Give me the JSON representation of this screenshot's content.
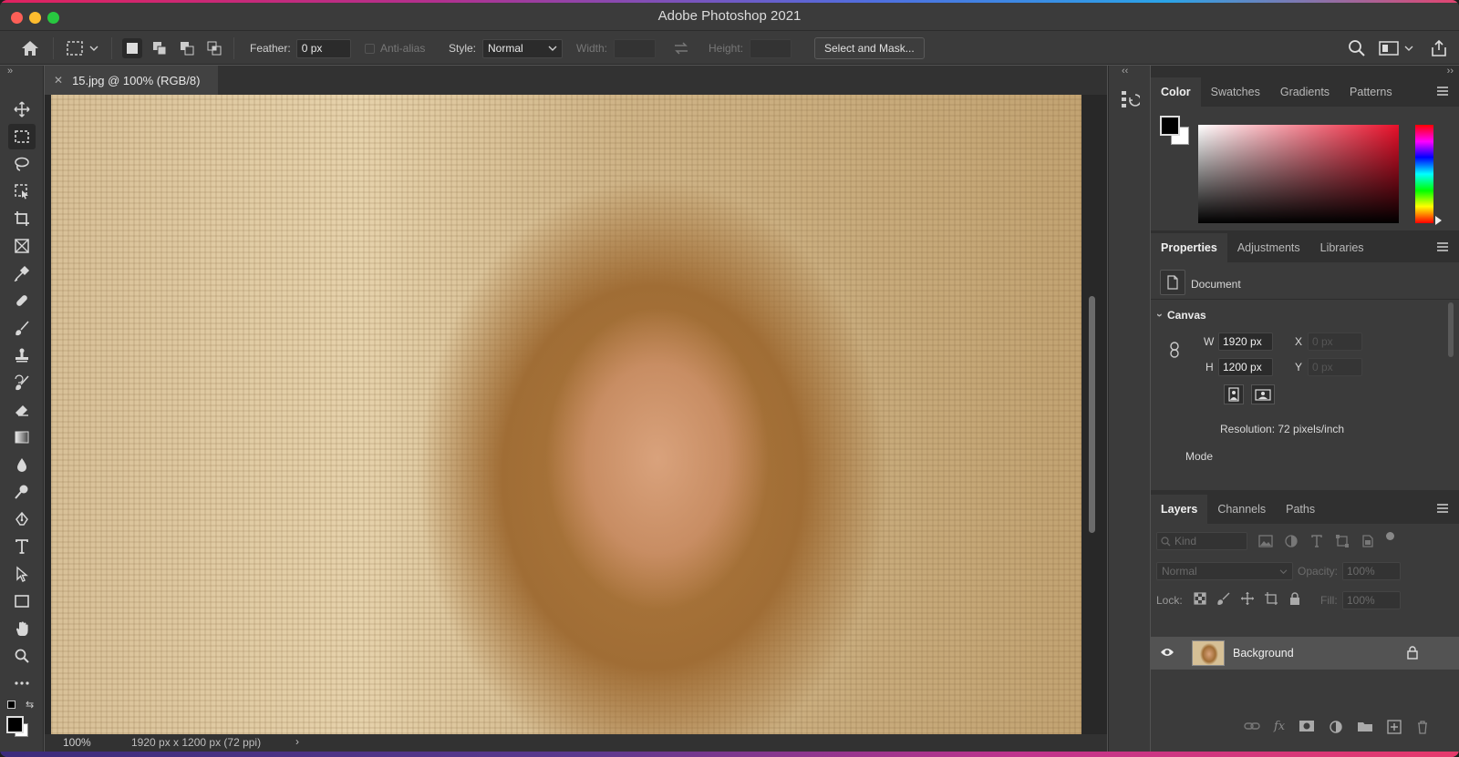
{
  "app": {
    "title": "Adobe Photoshop 2021"
  },
  "options_bar": {
    "feather_label": "Feather:",
    "feather_value": "0 px",
    "anti_alias_label": "Anti-alias",
    "style_label": "Style:",
    "style_value": "Normal",
    "width_label": "Width:",
    "height_label": "Height:",
    "select_mask_label": "Select and Mask..."
  },
  "document": {
    "tab_title": "15.jpg @ 100% (RGB/8)",
    "zoom": "100%",
    "dimensions": "1920 px x 1200 px (72 ppi)"
  },
  "color_panel": {
    "tabs": [
      "Color",
      "Swatches",
      "Gradients",
      "Patterns"
    ],
    "accent_color": "#e8102a"
  },
  "properties_panel": {
    "tabs": [
      "Properties",
      "Adjustments",
      "Libraries"
    ],
    "document_label": "Document",
    "section": "Canvas",
    "w_label": "W",
    "w_value": "1920 px",
    "h_label": "H",
    "h_value": "1200 px",
    "x_label": "X",
    "x_value": "0 px",
    "y_label": "Y",
    "y_value": "0 px",
    "resolution": "Resolution: 72 pixels/inch",
    "mode_label": "Mode"
  },
  "layers_panel": {
    "tabs": [
      "Layers",
      "Channels",
      "Paths"
    ],
    "kind_placeholder": "Kind",
    "blend_mode": "Normal",
    "opacity_label": "Opacity:",
    "opacity_value": "100%",
    "lock_label": "Lock:",
    "fill_label": "Fill:",
    "fill_value": "100%",
    "layers": [
      {
        "name": "Background",
        "visible": true,
        "locked": true
      }
    ]
  },
  "tools": [
    "move-tool",
    "marquee-tool",
    "lasso-tool",
    "object-select-tool",
    "crop-tool",
    "frame-tool",
    "eyedropper-tool",
    "healing-brush-tool",
    "brush-tool",
    "clone-stamp-tool",
    "history-brush-tool",
    "eraser-tool",
    "gradient-tool",
    "blur-tool",
    "dodge-tool",
    "pen-tool",
    "type-tool",
    "path-select-tool",
    "rectangle-tool",
    "hand-tool",
    "zoom-tool",
    "more-tools"
  ]
}
